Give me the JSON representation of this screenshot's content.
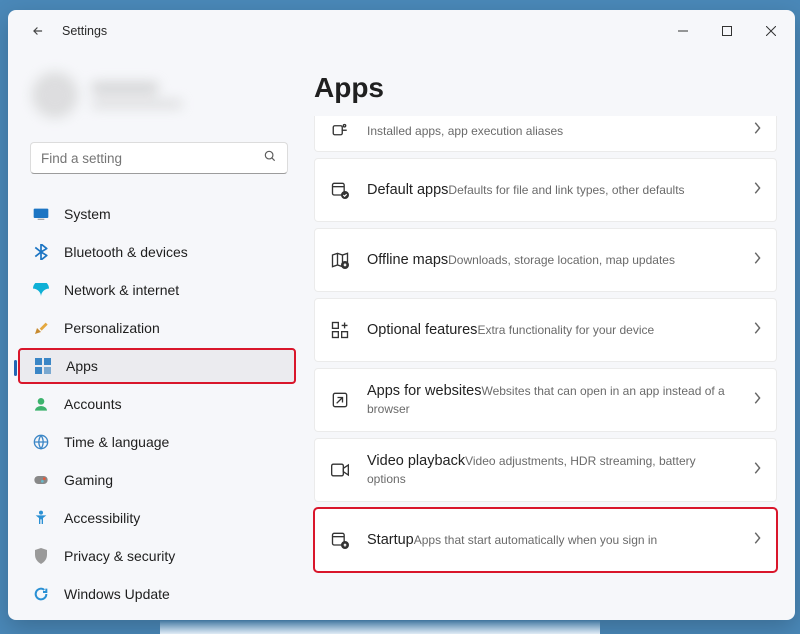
{
  "app": {
    "title": "Settings"
  },
  "search": {
    "placeholder": "Find a setting"
  },
  "sidebar": {
    "items": [
      {
        "label": "System",
        "icon": "system-icon",
        "selected": false
      },
      {
        "label": "Bluetooth & devices",
        "icon": "bluetooth-icon",
        "selected": false
      },
      {
        "label": "Network & internet",
        "icon": "network-icon",
        "selected": false
      },
      {
        "label": "Personalization",
        "icon": "personalization-icon",
        "selected": false
      },
      {
        "label": "Apps",
        "icon": "apps-icon",
        "selected": true
      },
      {
        "label": "Accounts",
        "icon": "accounts-icon",
        "selected": false
      },
      {
        "label": "Time & language",
        "icon": "time-language-icon",
        "selected": false
      },
      {
        "label": "Gaming",
        "icon": "gaming-icon",
        "selected": false
      },
      {
        "label": "Accessibility",
        "icon": "accessibility-icon",
        "selected": false
      },
      {
        "label": "Privacy & security",
        "icon": "privacy-icon",
        "selected": false
      },
      {
        "label": "Windows Update",
        "icon": "windows-update-icon",
        "selected": false
      }
    ]
  },
  "page": {
    "title": "Apps"
  },
  "cards": [
    {
      "key": "advanced",
      "partial": true,
      "title": "",
      "sub": "Installed apps, app execution aliases",
      "icon": "advanced-icon"
    },
    {
      "key": "default-apps",
      "title": "Default apps",
      "sub": "Defaults for file and link types, other defaults",
      "icon": "default-apps-icon"
    },
    {
      "key": "offline-maps",
      "title": "Offline maps",
      "sub": "Downloads, storage location, map updates",
      "icon": "offline-maps-icon"
    },
    {
      "key": "optional-features",
      "title": "Optional features",
      "sub": "Extra functionality for your device",
      "icon": "optional-features-icon"
    },
    {
      "key": "apps-for-websites",
      "title": "Apps for websites",
      "sub": "Websites that can open in an app instead of a browser",
      "icon": "apps-websites-icon"
    },
    {
      "key": "video-playback",
      "title": "Video playback",
      "sub": "Video adjustments, HDR streaming, battery options",
      "icon": "video-playback-icon"
    },
    {
      "key": "startup",
      "title": "Startup",
      "sub": "Apps that start automatically when you sign in",
      "icon": "startup-icon",
      "highlighted": true
    }
  ],
  "colors": {
    "highlight": "#d9162b",
    "accent": "#2366b5"
  }
}
